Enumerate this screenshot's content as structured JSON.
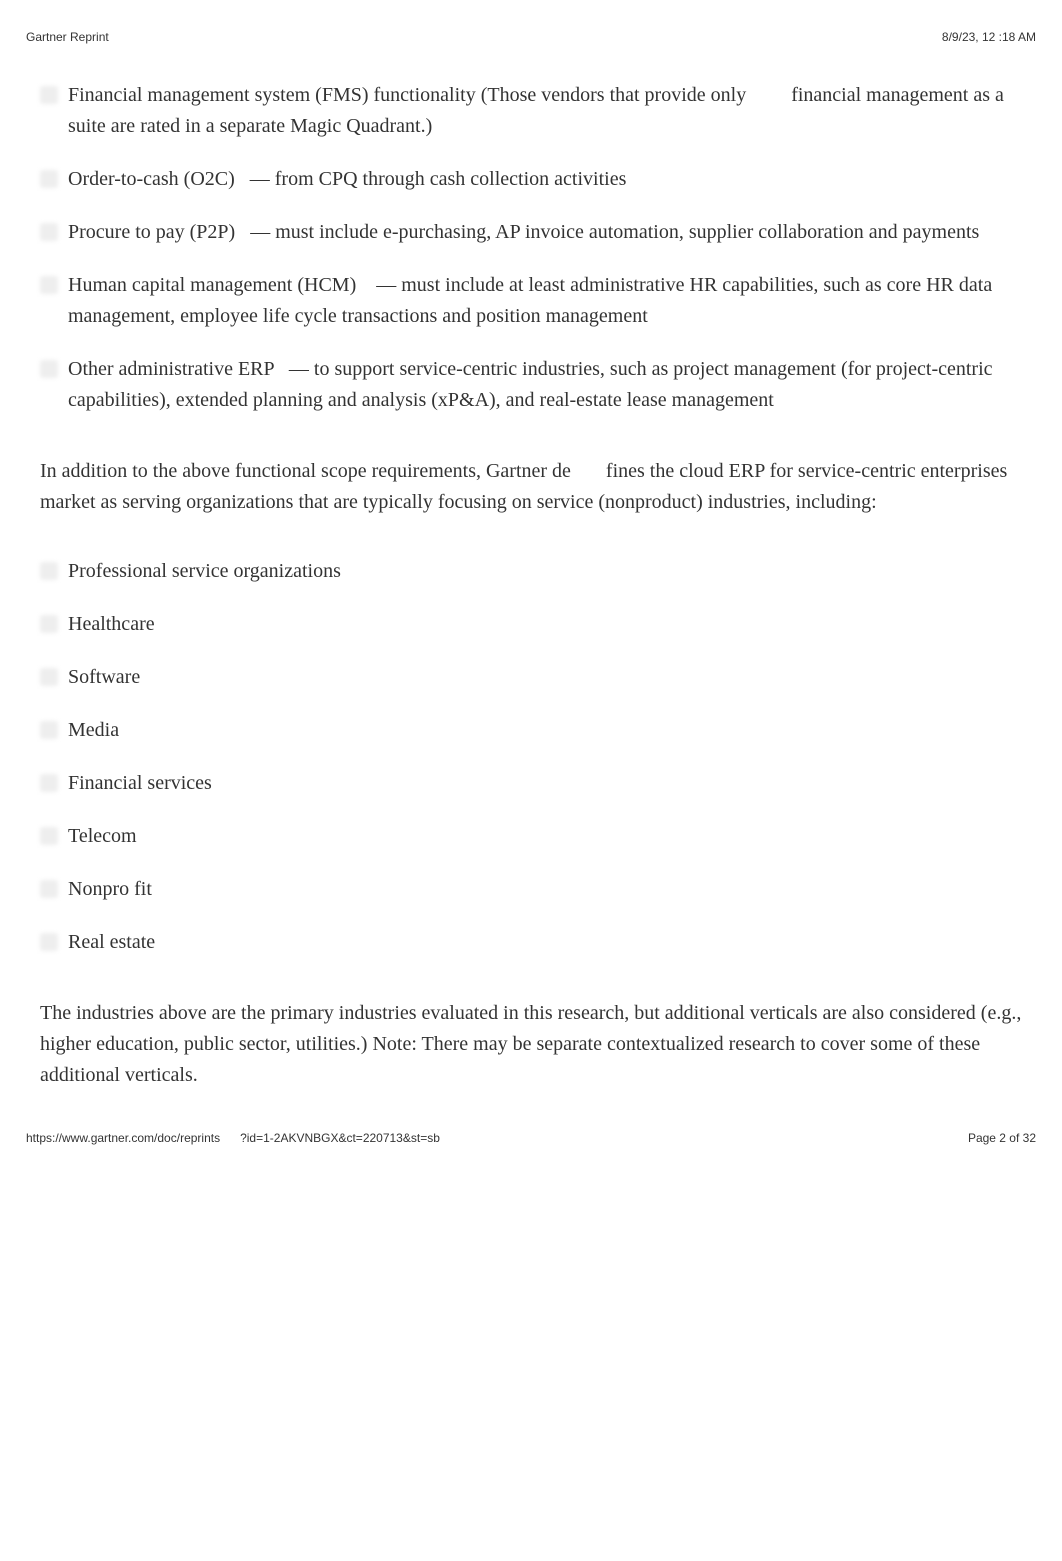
{
  "header": {
    "left": "Gartner Reprint",
    "right": "8/9/23, 12 :18 AM"
  },
  "list1": [
    "Financial management system (FMS) functionality (Those vendors that provide only         financial management as a suite are rated in a separate Magic Quadrant.)",
    "Order-to-cash (O2C)   — from CPQ through cash collection activities",
    "Procure to pay (P2P)   — must include e-purchasing, AP invoice automation, supplier collaboration and payments",
    "Human capital management (HCM)    — must include at least administrative HR capabilities, such as core HR data management, employee life cycle transactions and position management",
    "Other administrative ERP   — to support service-centric industries, such as project management (for project-centric capabilities), extended planning and analysis (xP&A), and real-estate lease management"
  ],
  "para1": "In addition to the above functional scope requirements, Gartner de       fines the cloud ERP for service-centric enterprises market as serving organizations that are typically focusing on service (nonproduct) industries, including:",
  "list2": [
    "Professional service organizations",
    "Healthcare",
    "Software",
    "Media",
    "Financial services",
    "Telecom",
    "Nonpro fit",
    "Real estate"
  ],
  "para2": "The industries above are the primary industries evaluated in this research, but additional verticals are also considered (e.g., higher education, public sector, utilities.) Note: There may be separate contextualized research to cover some of these additional verticals.",
  "footer": {
    "left": "https://www.gartner.com/doc/reprints      ?id=1-2AKVNBGX&ct=220713&st=sb",
    "right": "Page 2 of 32"
  }
}
